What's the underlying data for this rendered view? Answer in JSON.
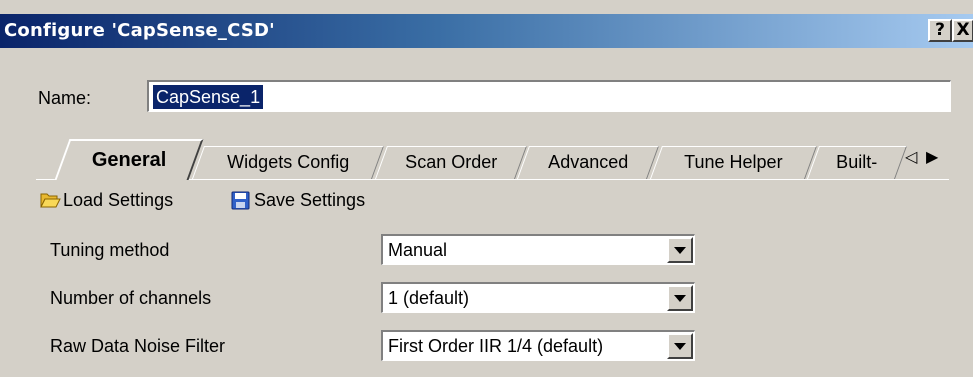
{
  "window": {
    "title": "Configure 'CapSense_CSD'",
    "help_label": "?",
    "close_label": "X"
  },
  "name_row": {
    "label": "Name:",
    "value": "CapSense_1"
  },
  "tabs": [
    {
      "label": "General",
      "active": true
    },
    {
      "label": "Widgets Config",
      "active": false
    },
    {
      "label": "Scan Order",
      "active": false
    },
    {
      "label": "Advanced",
      "active": false
    },
    {
      "label": "Tune Helper",
      "active": false
    },
    {
      "label": "Built-",
      "active": false
    }
  ],
  "tab_scroll": {
    "left": "◁",
    "right": "▶"
  },
  "toolbar": {
    "load_label": "Load Settings",
    "save_label": "Save Settings",
    "load_icon": "folder-open-icon",
    "save_icon": "floppy-disk-icon"
  },
  "properties": [
    {
      "label": "Tuning method",
      "value": "Manual"
    },
    {
      "label": "Number of channels",
      "value": "1 (default)"
    },
    {
      "label": "Raw Data Noise Filter",
      "value": "First Order IIR 1/4 (default)"
    }
  ],
  "colors": {
    "title_gradient_start": "#0a246a",
    "title_gradient_end": "#a6caf0",
    "face": "#d4d0c8",
    "selection": "#0a246a"
  }
}
